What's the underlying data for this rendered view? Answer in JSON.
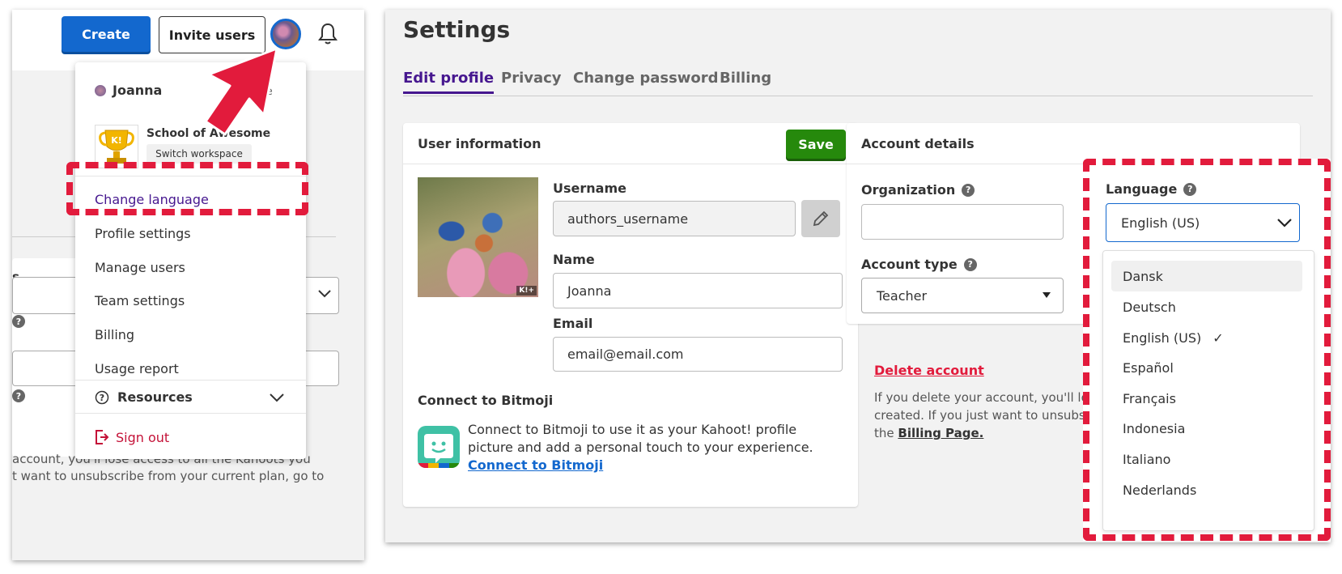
{
  "topbar": {
    "create_label": "Create",
    "invite_label": "Invite users"
  },
  "account_menu": {
    "user_name": "Joanna",
    "profile_link": "ofile",
    "workspace_name": "School of Awesome",
    "switch_workspace": "Switch workspace",
    "items": [
      "Change language",
      "Profile settings",
      "Manage users",
      "Team settings",
      "Billing",
      "Usage report"
    ],
    "resources_label": "Resources",
    "signout_label": "Sign out"
  },
  "left_background": {
    "section_letter": "s",
    "bottom_text_line1": "account, you'll lose access to all the Kahoots you",
    "bottom_text_line2": "t want to unsubscribe from your current plan, go to"
  },
  "settings": {
    "title": "Settings",
    "tabs": [
      "Edit profile",
      "Privacy",
      "Change password",
      "Billing"
    ],
    "active_tab": "Edit profile"
  },
  "user_information": {
    "heading": "User information",
    "save_label": "Save",
    "image_badge": "K!+",
    "username_label": "Username",
    "username_value": "authors_username",
    "name_label": "Name",
    "name_value": "Joanna",
    "email_label": "Email",
    "email_value": "email@email.com",
    "bitmoji_heading": "Connect to Bitmoji",
    "bitmoji_text": "Connect to Bitmoji to use it as your Kahoot! profile picture and add a personal touch to your experience.",
    "bitmoji_link": "Connect to Bitmoji"
  },
  "account_details": {
    "heading": "Account details",
    "organization_label": "Organization",
    "organization_value": "",
    "account_type_label": "Account type",
    "account_type_value": "Teacher",
    "language_label": "Language",
    "language_value": "English (US)",
    "delete_link": "Delete account",
    "delete_text_line1": "If you delete your account, you'll lose",
    "delete_text_line2": "created. If you just want to unsubscri",
    "delete_text_prefix": "the",
    "billing_page_link": "Billing Page."
  },
  "language_options": [
    {
      "label": "Dansk",
      "hover": true
    },
    {
      "label": "Deutsch"
    },
    {
      "label": "English (US)",
      "selected": true,
      "check": "✓"
    },
    {
      "label": "Español"
    },
    {
      "label": "Français"
    },
    {
      "label": "Indonesia"
    },
    {
      "label": "Italiano"
    },
    {
      "label": "Nederlands"
    }
  ],
  "colors": {
    "brand_blue": "#1368ce",
    "brand_purple": "#46178f",
    "save_green": "#26890c",
    "highlight_red": "#e21b3c"
  }
}
